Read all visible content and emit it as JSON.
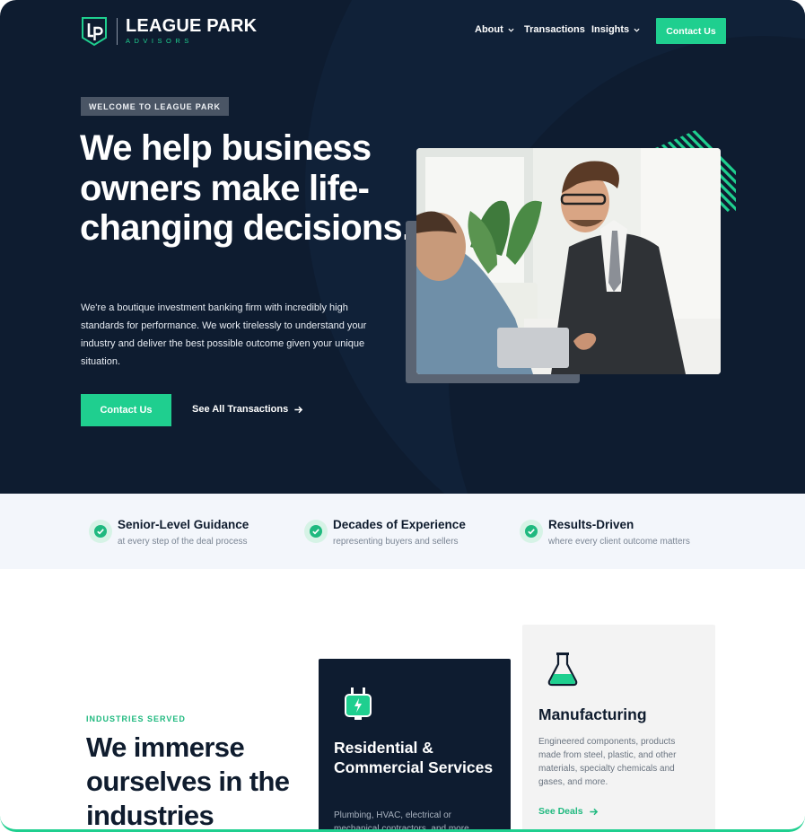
{
  "brand": {
    "name": "LEAGUE PARK",
    "tagline": "ADVISORS",
    "monogram": "Lp",
    "colors": {
      "navy": "#0e1c30",
      "accent": "#1fcf8f"
    }
  },
  "nav": {
    "items": [
      {
        "label": "About",
        "has_dropdown": true
      },
      {
        "label": "Transactions",
        "has_dropdown": false
      },
      {
        "label": "Insights",
        "has_dropdown": true
      }
    ],
    "cta_label": "Contact Us"
  },
  "hero": {
    "eyebrow": "WELCOME TO LEAGUE PARK",
    "headline": "We help business owners make life-changing decisions.",
    "body": "We're a boutique investment banking firm with incredibly high standards for performance. We work tirelessly to understand your industry and deliver the best possible outcome given your unique situation.",
    "primary_cta": "Contact Us",
    "secondary_cta": "See All Transactions",
    "secondary_icon": "arrow-right-icon"
  },
  "features": [
    {
      "icon": "check-circle-icon",
      "title": "Senior-Level Guidance",
      "subtitle": "at every step of the deal process"
    },
    {
      "icon": "check-circle-icon",
      "title": "Decades of Experience",
      "subtitle": "representing buyers and sellers"
    },
    {
      "icon": "check-circle-icon",
      "title": "Results-Driven",
      "subtitle": "where every client outcome matters"
    }
  ],
  "industries": {
    "label": "INDUSTRIES SERVED",
    "heading": "We immerse ourselves in the industries",
    "cards": [
      {
        "icon": "electric-plug-icon",
        "title": "Residential & Commercial Services",
        "description": "Plumbing, HVAC, electrical or mechanical contractors, and more"
      },
      {
        "icon": "flask-icon",
        "title": "Manufacturing",
        "description": "Engineered components, products made from steel, plastic, and other materials, specialty chemicals and gases, and more.",
        "link_label": "See Deals",
        "link_icon": "arrow-right-icon"
      }
    ]
  }
}
